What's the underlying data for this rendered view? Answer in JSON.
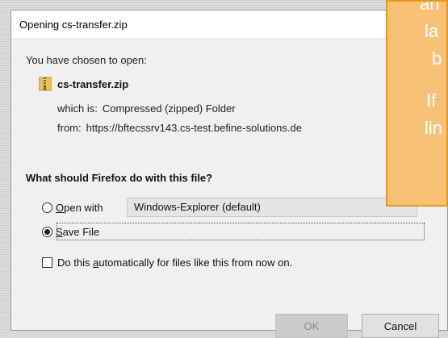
{
  "dialog": {
    "title": "Opening cs-transfer.zip",
    "intro": "You have chosen to open:",
    "file_name": "cs-transfer.zip",
    "which_is_label": "which is:",
    "which_is_value": "Compressed (zipped) Folder",
    "from_label": "from:",
    "from_value": "https://bftecssrv143.cs-test.befine-solutions.de",
    "question": "What should Firefox do with this file?",
    "open_with": {
      "accesskey": "O",
      "rest": "pen with",
      "selected": false,
      "app": "Windows-Explorer (default)"
    },
    "save_file": {
      "accesskey": "S",
      "rest": "ave File",
      "selected": true
    },
    "auto": {
      "pre": "Do this ",
      "accesskey": "a",
      "post": "utomatically for files like this from now on.",
      "checked": false
    },
    "ok_label": "OK",
    "cancel_label": "Cancel"
  },
  "callout": {
    "lines": [
      "an",
      "la",
      "b",
      "If",
      "lin"
    ],
    "color_fill": "#f7c276",
    "color_border": "#e8981e"
  }
}
